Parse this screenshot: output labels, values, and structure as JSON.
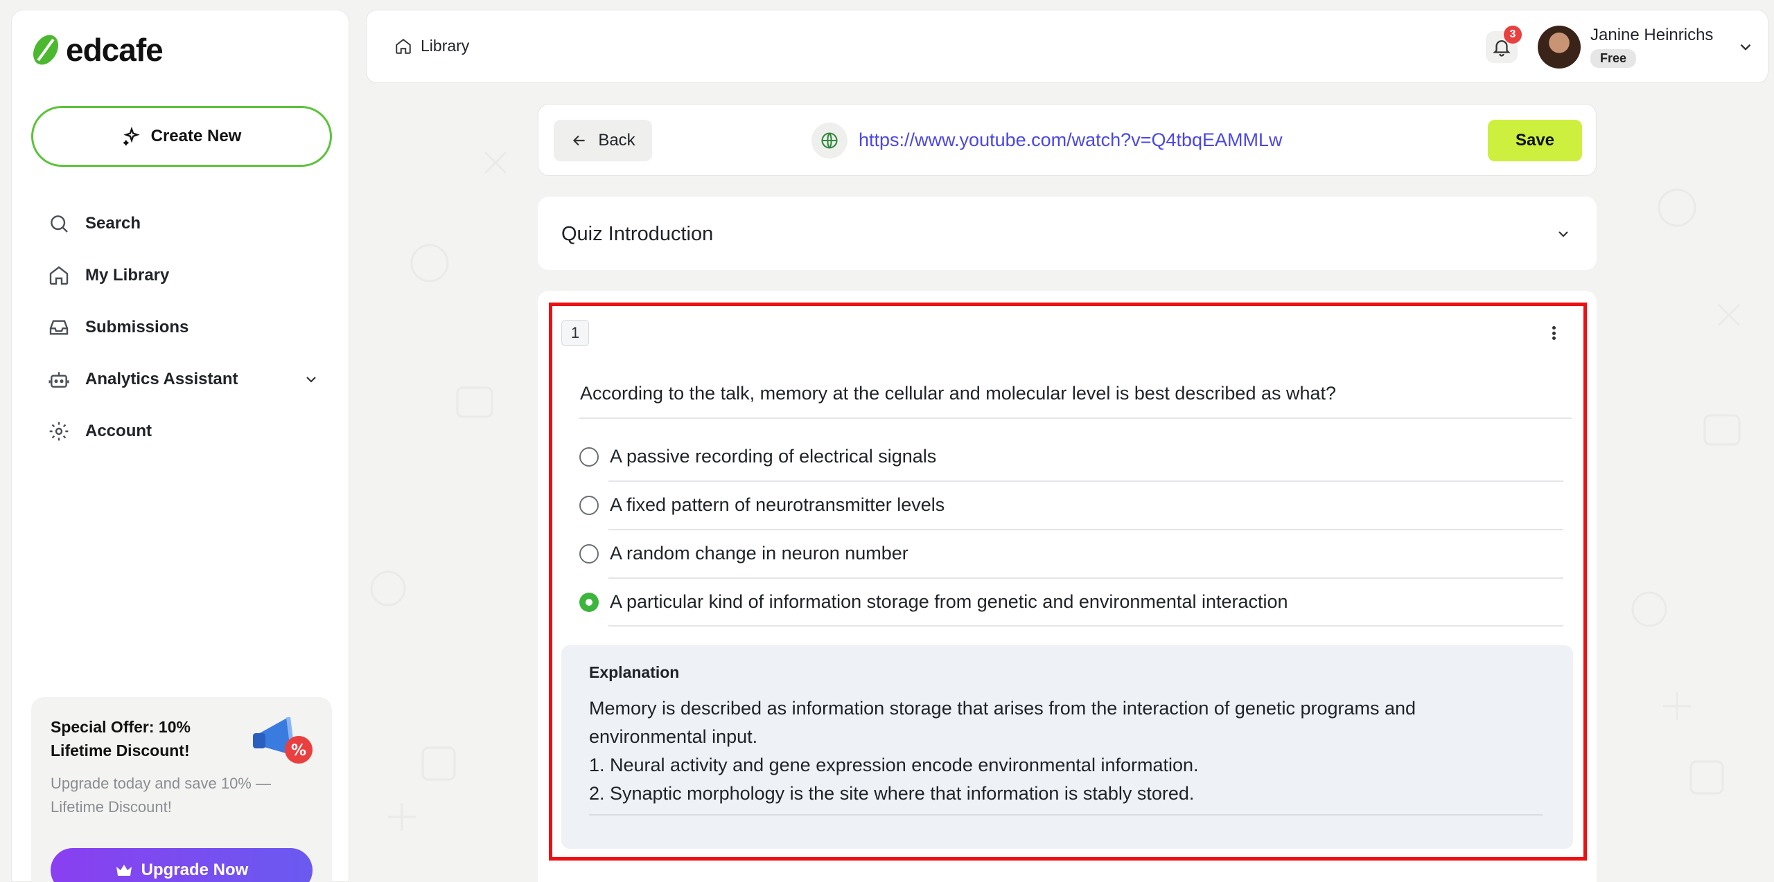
{
  "brand": {
    "name": "edcafe",
    "accent": "#5cc33a"
  },
  "sidebar": {
    "create_label": "Create New",
    "items": [
      {
        "label": "Search",
        "icon": "search-icon"
      },
      {
        "label": "My Library",
        "icon": "home-icon"
      },
      {
        "label": "Submissions",
        "icon": "inbox-icon"
      },
      {
        "label": "Analytics Assistant",
        "icon": "bot-icon"
      },
      {
        "label": "Account",
        "icon": "gear-icon"
      }
    ],
    "promo": {
      "title": "Special Offer: 10% Lifetime Discount!",
      "text": "Upgrade today and save 10% — Lifetime Discount!",
      "button": "Upgrade Now"
    }
  },
  "topbar": {
    "breadcrumb": "Library",
    "notifications": "3",
    "user_name": "Janine Heinrichs",
    "user_plan": "Free"
  },
  "urlbar": {
    "back_label": "Back",
    "url": "https://www.youtube.com/watch?v=Q4tbqEAMMLw",
    "save_label": "Save"
  },
  "intro": {
    "title": "Quiz Introduction"
  },
  "question": {
    "number": "1",
    "text": "According to the talk, memory at the cellular and molecular level is best described as what?",
    "options": [
      "A passive recording of electrical signals",
      "A fixed pattern of neurotransmitter levels",
      "A random change in neuron number",
      "A particular kind of information storage from genetic and environmental interaction"
    ],
    "selected_index": 3,
    "explanation_title": "Explanation",
    "explanation_lines": [
      "Memory is described as information storage that arises from the interaction of genetic programs and environmental input.",
      "1. Neural activity and gene expression encode environmental information.",
      "2. Synaptic morphology is the site where that information is stably stored."
    ]
  }
}
